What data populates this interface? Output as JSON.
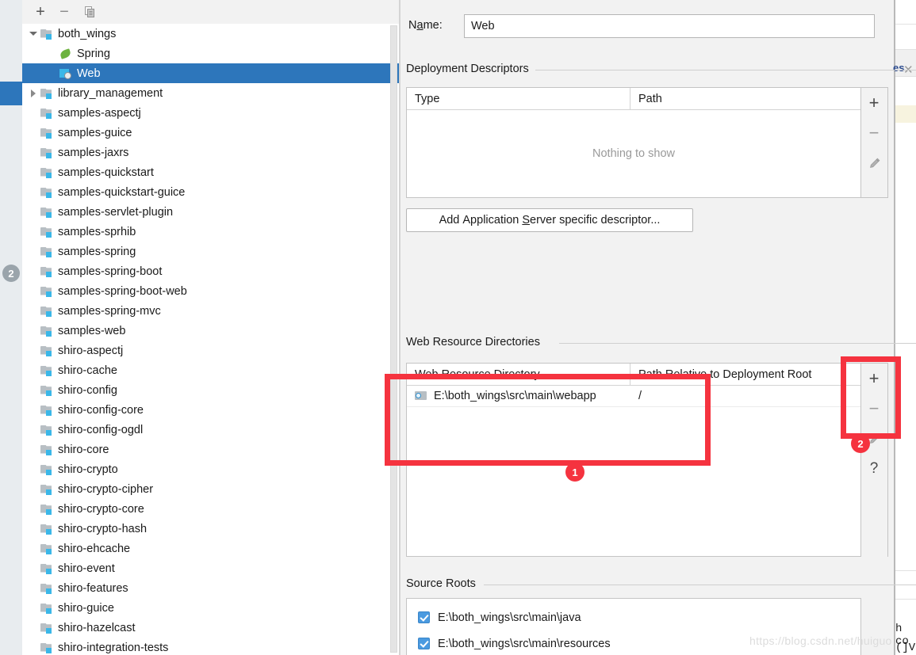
{
  "left_rail": {
    "badge": "2"
  },
  "tree_toolbar": {
    "add": "+",
    "remove": "−",
    "copy_icon": "copy-icon"
  },
  "tree": {
    "items": [
      {
        "label": "both_wings",
        "indent": 0,
        "twisty": "open",
        "icon": "module-folder-icon",
        "selected": false
      },
      {
        "label": "Spring",
        "indent": 1,
        "twisty": "none",
        "icon": "spring-leaf-icon",
        "selected": false
      },
      {
        "label": "Web",
        "indent": 1,
        "twisty": "none",
        "icon": "web-facet-icon",
        "selected": true
      },
      {
        "label": "library_management",
        "indent": 0,
        "twisty": "closed",
        "icon": "module-folder-icon",
        "selected": false
      },
      {
        "label": "samples-aspectj",
        "indent": 0,
        "twisty": "none",
        "icon": "module-folder-icon",
        "selected": false
      },
      {
        "label": "samples-guice",
        "indent": 0,
        "twisty": "none",
        "icon": "module-folder-icon",
        "selected": false
      },
      {
        "label": "samples-jaxrs",
        "indent": 0,
        "twisty": "none",
        "icon": "module-folder-icon",
        "selected": false
      },
      {
        "label": "samples-quickstart",
        "indent": 0,
        "twisty": "none",
        "icon": "module-folder-icon",
        "selected": false
      },
      {
        "label": "samples-quickstart-guice",
        "indent": 0,
        "twisty": "none",
        "icon": "module-folder-icon",
        "selected": false
      },
      {
        "label": "samples-servlet-plugin",
        "indent": 0,
        "twisty": "none",
        "icon": "module-folder-icon",
        "selected": false
      },
      {
        "label": "samples-sprhib",
        "indent": 0,
        "twisty": "none",
        "icon": "module-folder-icon",
        "selected": false
      },
      {
        "label": "samples-spring",
        "indent": 0,
        "twisty": "none",
        "icon": "module-folder-icon",
        "selected": false
      },
      {
        "label": "samples-spring-boot",
        "indent": 0,
        "twisty": "none",
        "icon": "module-folder-icon",
        "selected": false
      },
      {
        "label": "samples-spring-boot-web",
        "indent": 0,
        "twisty": "none",
        "icon": "module-folder-icon",
        "selected": false
      },
      {
        "label": "samples-spring-mvc",
        "indent": 0,
        "twisty": "none",
        "icon": "module-folder-icon",
        "selected": false
      },
      {
        "label": "samples-web",
        "indent": 0,
        "twisty": "none",
        "icon": "module-folder-icon",
        "selected": false
      },
      {
        "label": "shiro-aspectj",
        "indent": 0,
        "twisty": "none",
        "icon": "module-folder-icon",
        "selected": false
      },
      {
        "label": "shiro-cache",
        "indent": 0,
        "twisty": "none",
        "icon": "module-folder-icon",
        "selected": false
      },
      {
        "label": "shiro-config",
        "indent": 0,
        "twisty": "none",
        "icon": "module-folder-icon",
        "selected": false
      },
      {
        "label": "shiro-config-core",
        "indent": 0,
        "twisty": "none",
        "icon": "module-folder-icon",
        "selected": false
      },
      {
        "label": "shiro-config-ogdl",
        "indent": 0,
        "twisty": "none",
        "icon": "module-folder-icon",
        "selected": false
      },
      {
        "label": "shiro-core",
        "indent": 0,
        "twisty": "none",
        "icon": "module-folder-icon",
        "selected": false
      },
      {
        "label": "shiro-crypto",
        "indent": 0,
        "twisty": "none",
        "icon": "module-folder-icon",
        "selected": false
      },
      {
        "label": "shiro-crypto-cipher",
        "indent": 0,
        "twisty": "none",
        "icon": "module-folder-icon",
        "selected": false
      },
      {
        "label": "shiro-crypto-core",
        "indent": 0,
        "twisty": "none",
        "icon": "module-folder-icon",
        "selected": false
      },
      {
        "label": "shiro-crypto-hash",
        "indent": 0,
        "twisty": "none",
        "icon": "module-folder-icon",
        "selected": false
      },
      {
        "label": "shiro-ehcache",
        "indent": 0,
        "twisty": "none",
        "icon": "module-folder-icon",
        "selected": false
      },
      {
        "label": "shiro-event",
        "indent": 0,
        "twisty": "none",
        "icon": "module-folder-icon",
        "selected": false
      },
      {
        "label": "shiro-features",
        "indent": 0,
        "twisty": "none",
        "icon": "module-folder-icon",
        "selected": false
      },
      {
        "label": "shiro-guice",
        "indent": 0,
        "twisty": "none",
        "icon": "module-folder-icon",
        "selected": false
      },
      {
        "label": "shiro-hazelcast",
        "indent": 0,
        "twisty": "none",
        "icon": "module-folder-icon",
        "selected": false
      },
      {
        "label": "shiro-integration-tests",
        "indent": 0,
        "twisty": "none",
        "icon": "module-folder-icon",
        "selected": false
      }
    ]
  },
  "facet": {
    "name_label": "Name:",
    "name_label_mnemonic": "a",
    "name_value": "Web",
    "deployment_descriptors": {
      "title": "Deployment Descriptors",
      "columns": [
        "Type",
        "Path"
      ],
      "rows": [],
      "empty_text": "Nothing to show",
      "tools": [
        "+",
        "−",
        "edit-pencil-icon"
      ]
    },
    "add_descriptor_button": "Add Application Server specific descriptor...",
    "add_descriptor_button_mnemonic": "S",
    "web_resource_directories": {
      "title": "Web Resource Directories",
      "columns": [
        "Web Resource Directory",
        "Path Relative to Deployment Root"
      ],
      "rows": [
        {
          "directory": "E:\\both_wings\\src\\main\\webapp",
          "path": "/"
        }
      ],
      "tools": [
        "+",
        "−",
        "edit-pencil-icon",
        "?"
      ]
    },
    "source_roots": {
      "title": "Source Roots",
      "rows": [
        {
          "path": "E:\\both_wings\\src\\main\\java",
          "checked": true
        },
        {
          "path": "E:\\both_wings\\src\\main\\resources",
          "checked": true
        }
      ]
    }
  },
  "background_window": {
    "tab_text": "es",
    "close_icon": "close-icon",
    "code_line_1": "h co",
    "code_line_2": "(]VM"
  },
  "annotations": [
    {
      "id": "1",
      "label": "1",
      "target": "web-resource-directories-table"
    },
    {
      "id": "2",
      "label": "2",
      "target": "web-resource-directories-toolbar"
    }
  ],
  "watermark": "https://blog.csdn.net/huiguo",
  "colors": {
    "selection_blue": "#2d76bb",
    "annotation_red": "#f5333f",
    "checkbox_blue": "#4a9ae0",
    "panel_bg": "#f2f2f2",
    "spring_green": "#6db33f",
    "badge_grey": "#9aa4ab"
  }
}
